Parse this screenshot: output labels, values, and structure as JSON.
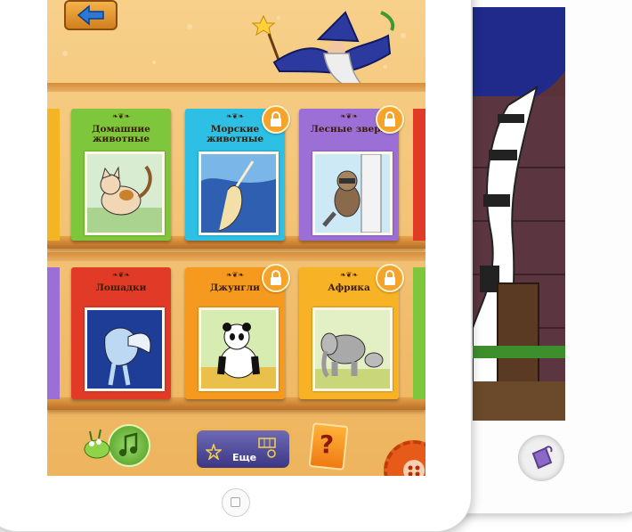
{
  "screen": {
    "categories": [
      {
        "title": "Домашние\nживотные",
        "locked": false,
        "color": "#7ec63b"
      },
      {
        "title": "Морские\nживотные",
        "locked": true,
        "color": "#2dbfe4"
      },
      {
        "title": "Лесные звери",
        "locked": true,
        "color": "#9c6fd6"
      },
      {
        "title": "Лошадки",
        "locked": false,
        "color": "#e13a26"
      },
      {
        "title": "Джунгли",
        "locked": true,
        "color": "#f59a1e"
      },
      {
        "title": "Африка",
        "locked": true,
        "color": "#f8b226"
      }
    ],
    "toolbar": {
      "more_label": "Еще",
      "help_label": "?"
    },
    "icons": {
      "back": "arrow-left-icon",
      "lock": "lock-icon",
      "music": "music-note-icon",
      "settings": "gear-icon",
      "star": "star-icon",
      "paint": "paint-bucket-icon"
    }
  }
}
